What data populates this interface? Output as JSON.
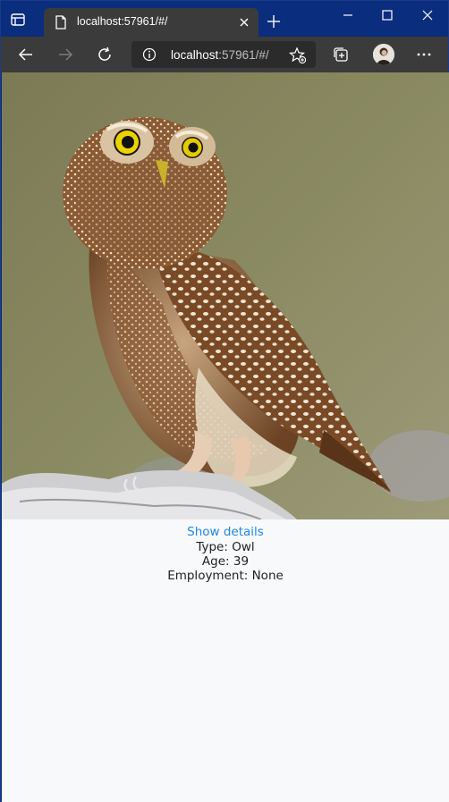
{
  "browser": {
    "tab_title": "localhost:57961/#/",
    "url_host": "localhost",
    "url_rest": ":57961/#/"
  },
  "theme": {
    "titlebar": "#0b2d7e",
    "toolbar": "#3b3b3b",
    "link": "#1e88e5"
  },
  "icons": {
    "tab_actions": "tab-actions-icon",
    "page": "page-icon",
    "close": "close-icon",
    "new_tab": "plus-icon",
    "back": "back-arrow-icon",
    "forward": "forward-arrow-icon",
    "reload": "reload-icon",
    "info": "info-icon",
    "favorite": "favorite-star-icon",
    "collections": "collections-icon",
    "more": "ellipsis-icon"
  },
  "content": {
    "show_details_label": "Show details",
    "type_line": "Type: Owl",
    "age_line": "Age: 39",
    "employment_line": "Employment: None"
  }
}
